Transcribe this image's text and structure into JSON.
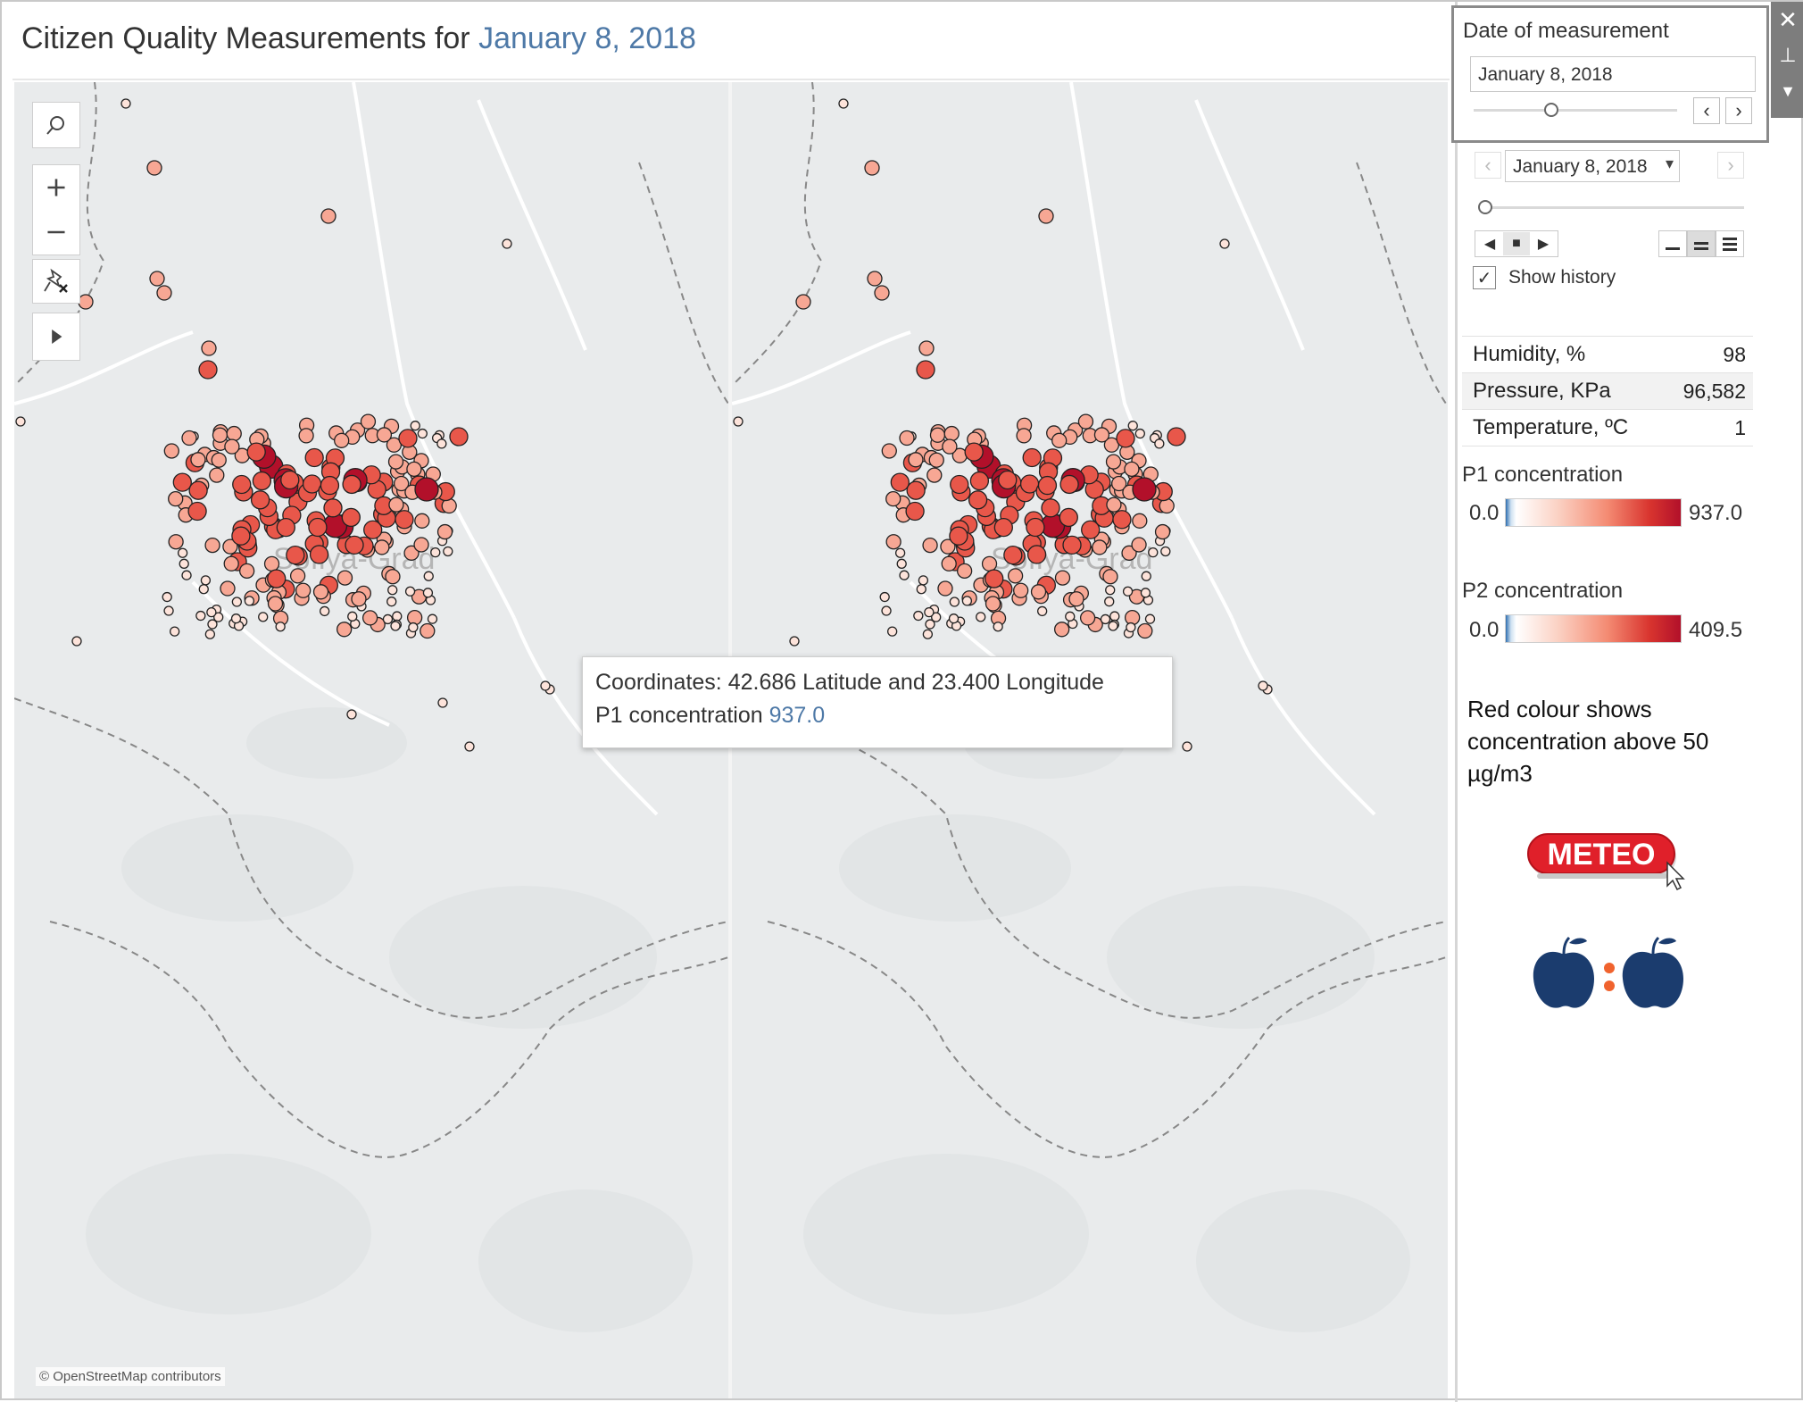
{
  "title": {
    "prefix": "Citizen Quality Measurements for",
    "date": "January 8, 2018"
  },
  "map": {
    "attribution": "© OpenStreetMap contributors",
    "place_label": "Sofiya-Grad",
    "tools": [
      "search-icon",
      "zoom-in-icon",
      "zoom-out-icon",
      "unpin-icon",
      "play-icon"
    ]
  },
  "tooltip": {
    "line1": "Coordinates: 42.686 Latitude and 23.400 Longitude",
    "line2_label": "P1 concentration",
    "line2_value": "937.0"
  },
  "date_panel": {
    "header": "Date of measurement",
    "value": "January 8, 2018",
    "slider_fraction": 0.38
  },
  "page_control": {
    "selected": "January 8, 2018",
    "slider_fraction": 0.0,
    "show_history_label": "Show history",
    "show_history_checked": true
  },
  "weather": {
    "rows": [
      {
        "label": "Humidity, %",
        "value": "98"
      },
      {
        "label": "Pressure, KPa",
        "value": "96,582"
      },
      {
        "label": "Temperature, ºC",
        "value": "1"
      }
    ]
  },
  "legends": {
    "p1": {
      "title": "P1 concentration",
      "min": "0.0",
      "max": "937.0"
    },
    "p2": {
      "title": "P2 concentration",
      "min": "0.0",
      "max": "409.5"
    }
  },
  "note": "Red colour shows concentration above 50 µg/m3",
  "meteo_label": "METEO",
  "colors": {
    "accent": "#4e79a7",
    "high": "#b2102a",
    "mid": "#e8574a",
    "low": "#fbd0c2",
    "blue": "#2f6fb1",
    "map_bg": "#e9ebec"
  }
}
